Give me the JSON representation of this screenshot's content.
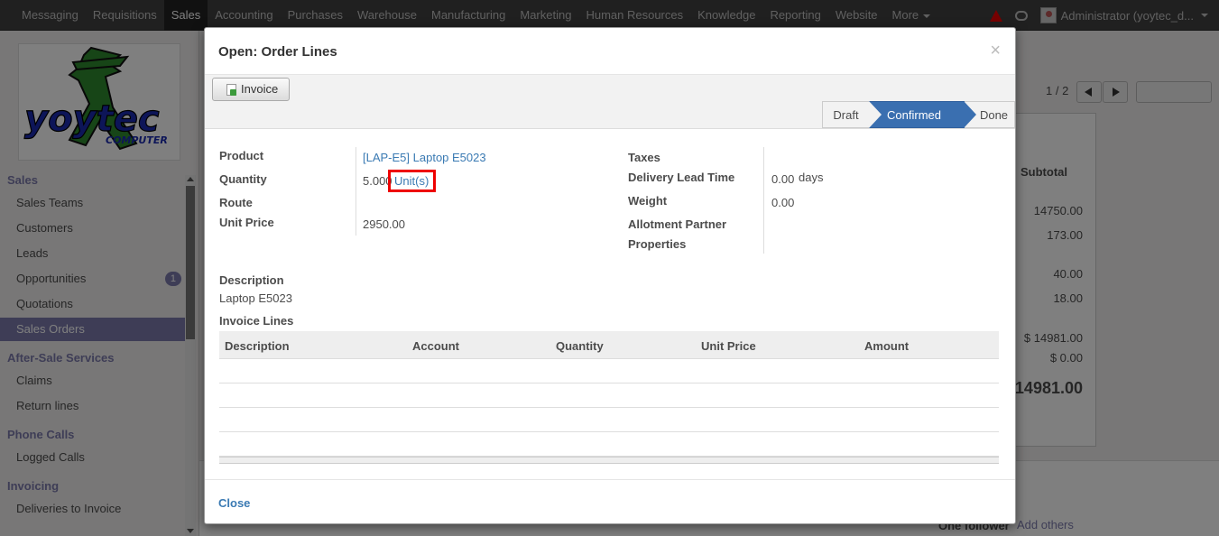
{
  "topnav": {
    "items": [
      "Messaging",
      "Requisitions",
      "Sales",
      "Accounting",
      "Purchases",
      "Warehouse",
      "Manufacturing",
      "Marketing",
      "Human Resources",
      "Knowledge",
      "Reporting",
      "Website",
      "More"
    ],
    "user": "Administrator (yoytec_d..."
  },
  "sidebar": {
    "sales_header": "Sales",
    "sales_items": [
      "Sales Teams",
      "Customers",
      "Leads",
      "Opportunities",
      "Quotations",
      "Sales Orders"
    ],
    "opportunities_badge": "1",
    "after_sale_header": "After-Sale Services",
    "after_sale_items": [
      "Claims",
      "Return lines"
    ],
    "phone_header": "Phone Calls",
    "phone_items": [
      "Logged Calls"
    ],
    "invoicing_header": "Invoicing",
    "invoicing_items": [
      "Deliveries to Invoice"
    ]
  },
  "background": {
    "pager": "1 / 2",
    "subtotal_header": "Subtotal",
    "values": [
      "14750.00",
      "173.00",
      "40.00",
      "18.00",
      "$ 14981.00",
      "$ 0.00"
    ],
    "total": "14981.00",
    "follower": "One follower",
    "add_others": "Add others"
  },
  "modal": {
    "title": "Open: Order Lines",
    "close_x": "×",
    "invoice_button": "Invoice",
    "status": {
      "draft": "Draft",
      "confirmed": "Confirmed",
      "done": "Done"
    },
    "left_fields": {
      "product_label": "Product",
      "product_value": "[LAP-E5] Laptop E5023",
      "quantity_label": "Quantity",
      "quantity_value": "5.000",
      "quantity_uom": "Unit(s)",
      "route_label": "Route",
      "unit_price_label": "Unit Price",
      "unit_price_value": "2950.00"
    },
    "right_fields": {
      "taxes_label": "Taxes",
      "lead_time_label": "Delivery Lead Time",
      "lead_time_value": "0.00",
      "lead_time_unit": "days",
      "weight_label": "Weight",
      "weight_value": "0.00",
      "allotment_label": "Allotment Partner",
      "properties_label": "Properties"
    },
    "description_label": "Description",
    "description_value": "Laptop E5023",
    "invoice_lines_label": "Invoice Lines",
    "table_headers": [
      "Description",
      "Account",
      "Quantity",
      "Unit Price",
      "Amount"
    ],
    "close_button": "Close"
  },
  "colors": {
    "accent": "#7c7bad",
    "status_active": "#3a6fb0",
    "link": "#3a7ab3",
    "highlight": "#ee0000"
  }
}
